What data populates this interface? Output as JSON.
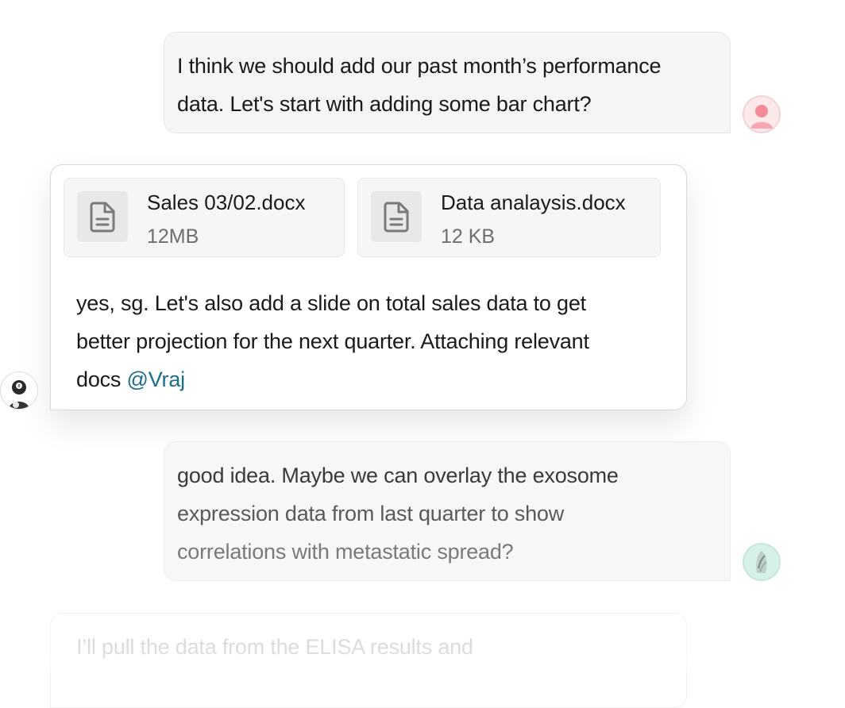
{
  "messages": [
    {
      "direction": "outgoing",
      "lines": [
        "I think we should add our past month’s performance",
        "data. Let's start with adding some bar chart?"
      ]
    },
    {
      "direction": "incoming",
      "attachments": [
        {
          "icon": "document-icon",
          "name": "Sales 03/02.docx",
          "size": "12MB"
        },
        {
          "icon": "document-icon",
          "name": "Data analaysis.docx",
          "size": "12 KB"
        }
      ],
      "lines": [
        "yes, sg.  Let's also add a slide on total sales data to get",
        "better projection for the next quarter. Attaching relevant"
      ],
      "last_line_prefix": "docs ",
      "mention": "@Vraj"
    },
    {
      "direction": "outgoing",
      "lines": [
        "good idea. Maybe we can overlay the exosome",
        "expression data from last quarter to show",
        "correlations with metastatic spread?"
      ]
    },
    {
      "direction": "incoming",
      "lines": [
        "I’ll pull the data from the ELISA results and"
      ]
    }
  ],
  "colors": {
    "mention": "#1a6d8e",
    "outgoing_bubble": "#f5f5f5",
    "incoming_bubble": "#ffffff"
  }
}
